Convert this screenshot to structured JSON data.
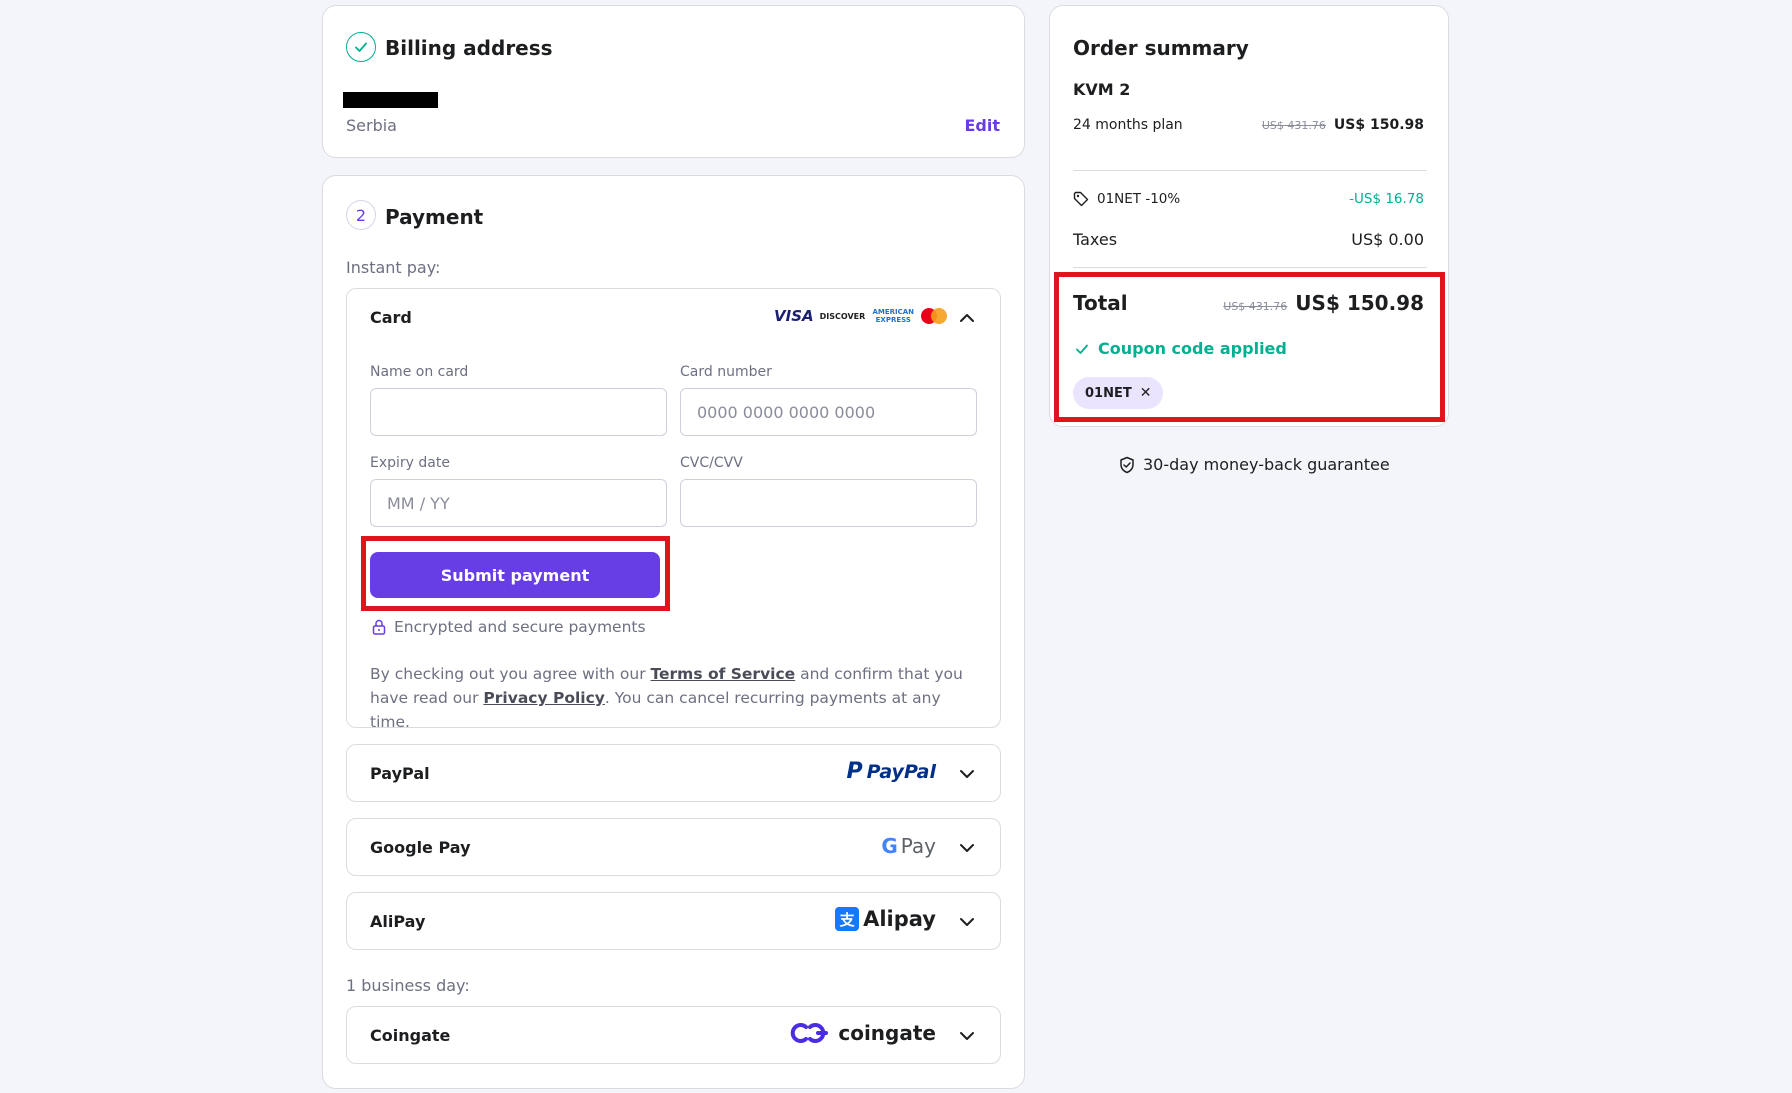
{
  "billing": {
    "title": "Billing address",
    "country": "Serbia",
    "edit_label": "Edit"
  },
  "payment": {
    "step_number": "2",
    "title": "Payment",
    "instant_label": "Instant pay:",
    "card": {
      "title": "Card",
      "brands": [
        "VISA",
        "DISCOVER",
        "AMERICAN EXPRESS",
        "Mastercard"
      ],
      "name_label": "Name on card",
      "name_value": "",
      "number_label": "Card number",
      "number_placeholder": "0000 0000 0000 0000",
      "expiry_label": "Expiry date",
      "expiry_placeholder": "MM / YY",
      "cvc_label": "CVC/CVV",
      "cvc_value": "",
      "submit_label": "Submit payment",
      "secure_label": "Encrypted and secure payments",
      "legal_pre": "By checking out you agree with our ",
      "terms_link": "Terms of Service",
      "legal_mid": " and confirm that you have read our ",
      "privacy_link": "Privacy Policy",
      "legal_post": ". You can cancel recurring payments at any time."
    },
    "methods": [
      {
        "name": "PayPal",
        "logo": "PayPal"
      },
      {
        "name": "Google Pay",
        "logo": "Pay"
      },
      {
        "name": "AliPay",
        "logo": "Alipay"
      }
    ],
    "business_label": "1 business day:",
    "coingate": {
      "name": "Coingate",
      "logo": "coingate"
    }
  },
  "summary": {
    "title": "Order summary",
    "product": "KVM 2",
    "plan": "24 months plan",
    "plan_old_price": "US$ 431.76",
    "plan_price": "US$ 150.98",
    "coupon_line": "01NET -10%",
    "coupon_discount": "-US$ 16.78",
    "taxes_label": "Taxes",
    "taxes_value": "US$ 0.00",
    "total_label": "Total",
    "total_old": "US$ 431.76",
    "total_value": "US$ 150.98",
    "coupon_applied": "Coupon code applied",
    "coupon_chip": "01NET",
    "guarantee": "30-day money-back guarantee"
  },
  "colors": {
    "accent": "#673de6",
    "success": "#00b090",
    "highlight": "#e3131d"
  }
}
